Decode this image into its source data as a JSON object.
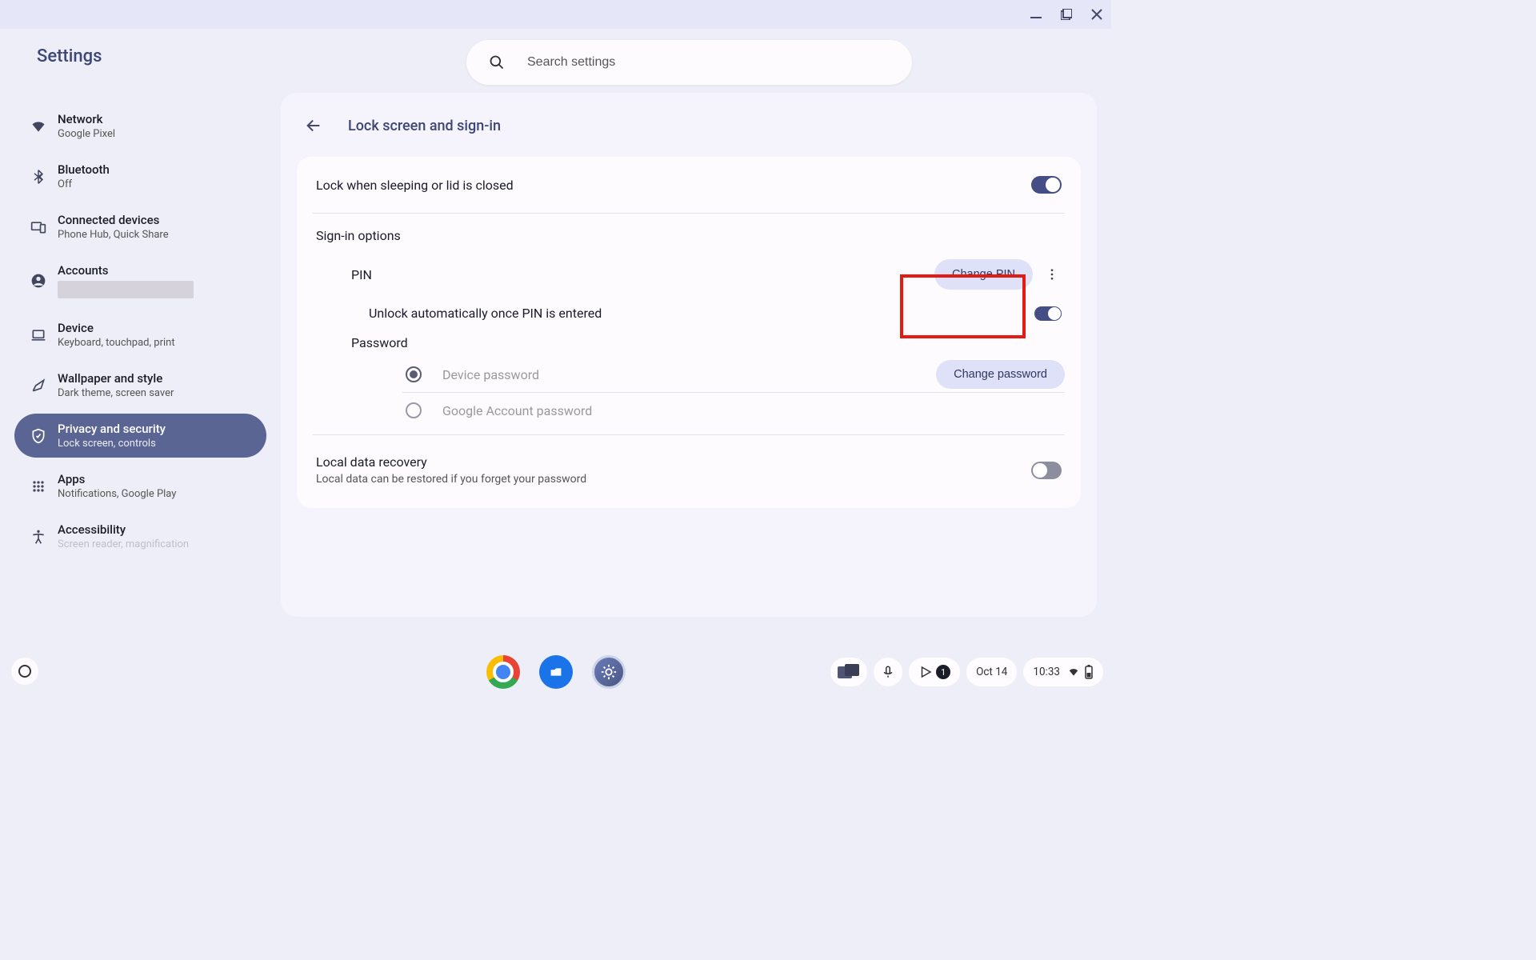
{
  "app_title": "Settings",
  "search": {
    "placeholder": "Search settings"
  },
  "sidebar": {
    "items": [
      {
        "label": "Network",
        "sub": "Google Pixel"
      },
      {
        "label": "Bluetooth",
        "sub": "Off"
      },
      {
        "label": "Connected devices",
        "sub": "Phone Hub, Quick Share"
      },
      {
        "label": "Accounts",
        "sub": ""
      },
      {
        "label": "Device",
        "sub": "Keyboard, touchpad, print"
      },
      {
        "label": "Wallpaper and style",
        "sub": "Dark theme, screen saver"
      },
      {
        "label": "Privacy and security",
        "sub": "Lock screen, controls"
      },
      {
        "label": "Apps",
        "sub": "Notifications, Google Play"
      },
      {
        "label": "Accessibility",
        "sub": "Screen reader, magnification"
      }
    ]
  },
  "page": {
    "title": "Lock screen and sign-in",
    "lock_sleep": {
      "label": "Lock when sleeping or lid is closed",
      "on": true
    },
    "signin_title": "Sign-in options",
    "pin": {
      "label": "PIN",
      "change_btn": "Change PIN",
      "auto_unlock": "Unlock automatically once PIN is entered",
      "auto_unlock_on": true
    },
    "password": {
      "label": "Password",
      "change_btn": "Change password",
      "options": [
        "Device password",
        "Google Account password"
      ],
      "selected": 0
    },
    "local_recovery": {
      "label": "Local data recovery",
      "sub": "Local data can be restored if you forget your password",
      "on": false
    }
  },
  "shelf": {
    "date": "Oct 14",
    "time": "10:33",
    "notification_count": "1"
  }
}
